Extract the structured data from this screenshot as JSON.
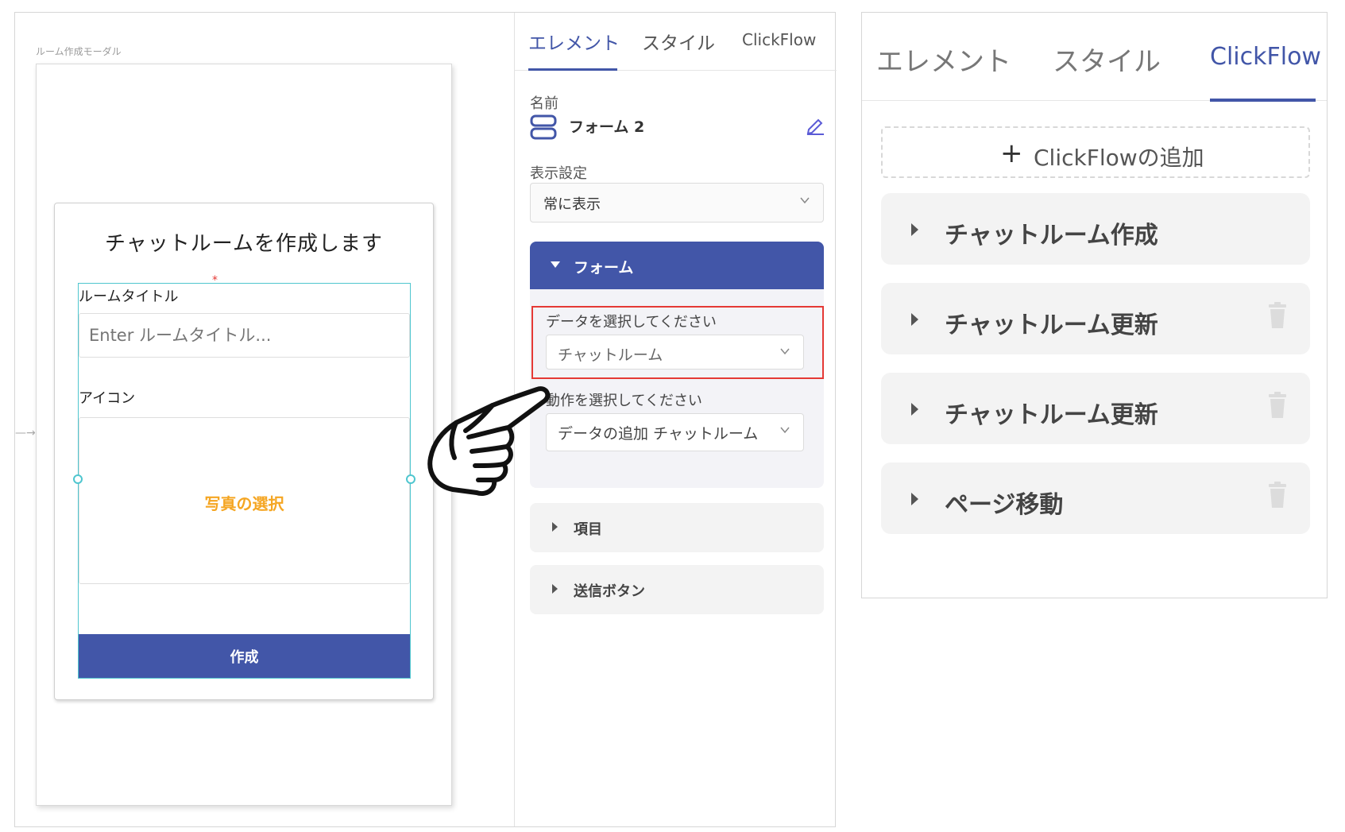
{
  "editor": {
    "canvas_label": "ルーム作成モーダル",
    "modal": {
      "title": "チャットルームを作成します",
      "room_title_label": "ルームタイトル",
      "room_title_placeholder": "Enter ルームタイトル...",
      "icon_label": "アイコン",
      "photo_select": "写真の選択",
      "submit_label": "作成"
    }
  },
  "properties": {
    "tabs": [
      "エレメント",
      "スタイル",
      "ClickFlow"
    ],
    "active_tab": "エレメント",
    "name_label": "名前",
    "name_value": "フォーム 2",
    "display_label": "表示設定",
    "display_value": "常に表示",
    "form_section": {
      "title": "フォーム",
      "data_label": "データを選択してください",
      "data_value": "チャットルーム",
      "action_label": "動作を選択してください",
      "action_value": "データの追加 チャットルーム"
    },
    "sections": [
      "項目",
      "送信ボタン"
    ]
  },
  "clickflow_panel": {
    "tabs": [
      "エレメント",
      "スタイル",
      "ClickFlow"
    ],
    "active_tab": "ClickFlow",
    "add_label": "ClickFlowの追加",
    "items": [
      {
        "label": "チャットルーム作成",
        "deletable": false
      },
      {
        "label": "チャットルーム更新",
        "deletable": true
      },
      {
        "label": "チャットルーム更新",
        "deletable": true
      },
      {
        "label": "ページ移動",
        "deletable": true
      }
    ]
  },
  "colors": {
    "accent": "#4256a8",
    "selection": "#4fc6cf",
    "highlight": "#e53935",
    "photo": "#f5a623"
  }
}
